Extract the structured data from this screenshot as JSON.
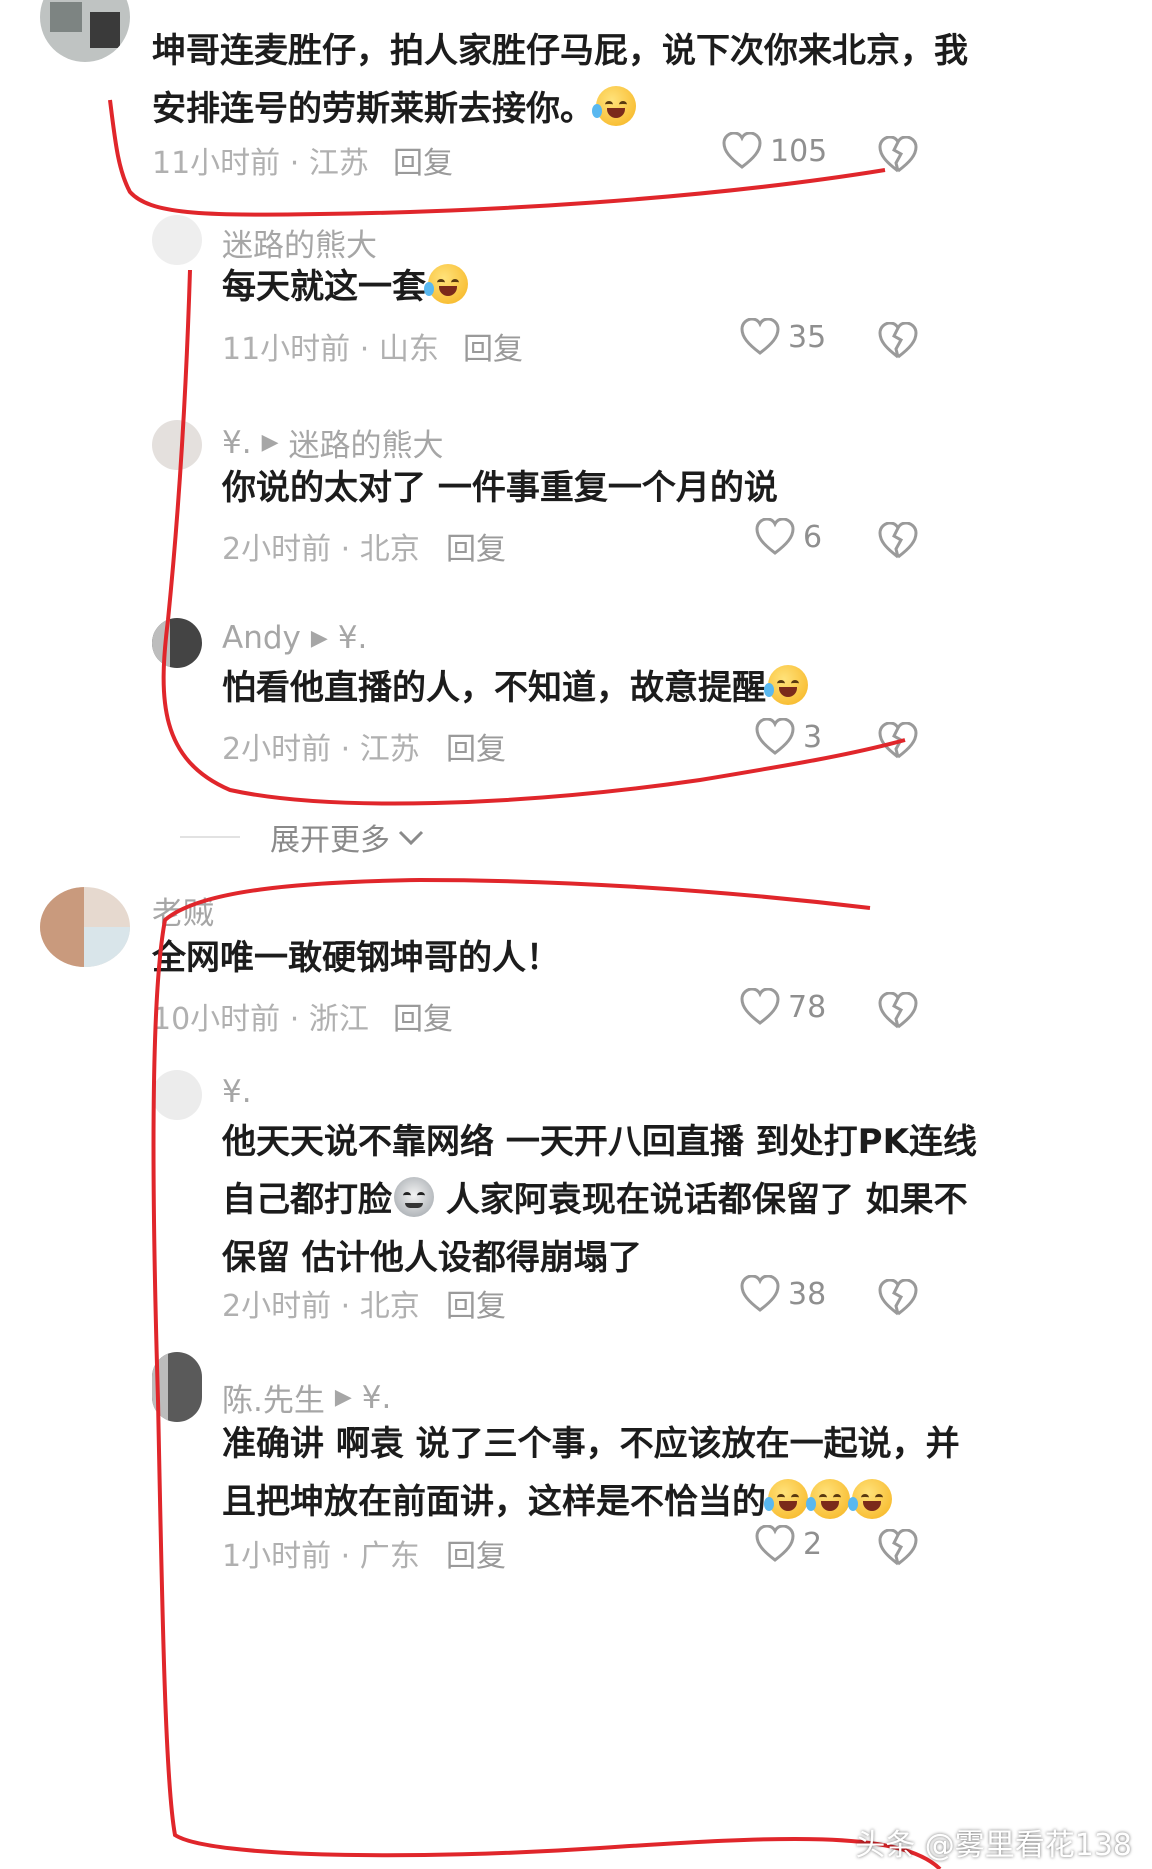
{
  "comments": [
    {
      "text_lines": [
        "坤哥连麦胜仔，拍人家胜仔马屁，说下次你来北京，我",
        "安排连号的劳斯莱斯去接你。"
      ],
      "emoji": "laughing-tears",
      "time": "11小时前",
      "location": "江苏",
      "reply_label": "回复",
      "likes": "105"
    },
    {
      "author": "迷路的熊大",
      "text": "每天就这一套",
      "emoji": "laughing-tears",
      "time": "11小时前",
      "location": "山东",
      "reply_label": "回复",
      "likes": "35"
    },
    {
      "author": "¥.",
      "reply_to": "迷路的熊大",
      "text": "你说的太对了 一件事重复一个月的说",
      "time": "2小时前",
      "location": "北京",
      "reply_label": "回复",
      "likes": "6"
    },
    {
      "author": "Andy",
      "reply_to": "¥.",
      "text": "怕看他直播的人，不知道，故意提醒",
      "emoji": "laughing-tears",
      "time": "2小时前",
      "location": "江苏",
      "reply_label": "回复",
      "likes": "3"
    },
    {
      "author": "老贼",
      "text": "全网唯一敢硬钢坤哥的人！",
      "time": "10小时前",
      "location": "浙江",
      "reply_label": "回复",
      "likes": "78"
    },
    {
      "author": "¥.",
      "text_lines": [
        "他天天说不靠网络 一天开八回直播 到处打PK连线",
        "自己都打脸",
        "人家阿袁现在说话都保留了 如果不",
        "保留 估计他人设都得崩塌了"
      ],
      "emoji": "doge",
      "time": "2小时前",
      "location": "北京",
      "reply_label": "回复",
      "likes": "38"
    },
    {
      "author": "陈.先生",
      "reply_to": "¥.",
      "text_lines": [
        "准确讲 啊袁 说了三个事，不应该放在一起说，并",
        "且把坤放在前面讲，这样是不恰当的"
      ],
      "emoji": "laughing-tears",
      "time": "1小时前",
      "location": "广东",
      "reply_label": "回复",
      "likes": "2"
    }
  ],
  "separator": "·",
  "expand_more": "展开更多",
  "watermark": "头条 @雾里看花138",
  "annotation_color": "#e0262b"
}
